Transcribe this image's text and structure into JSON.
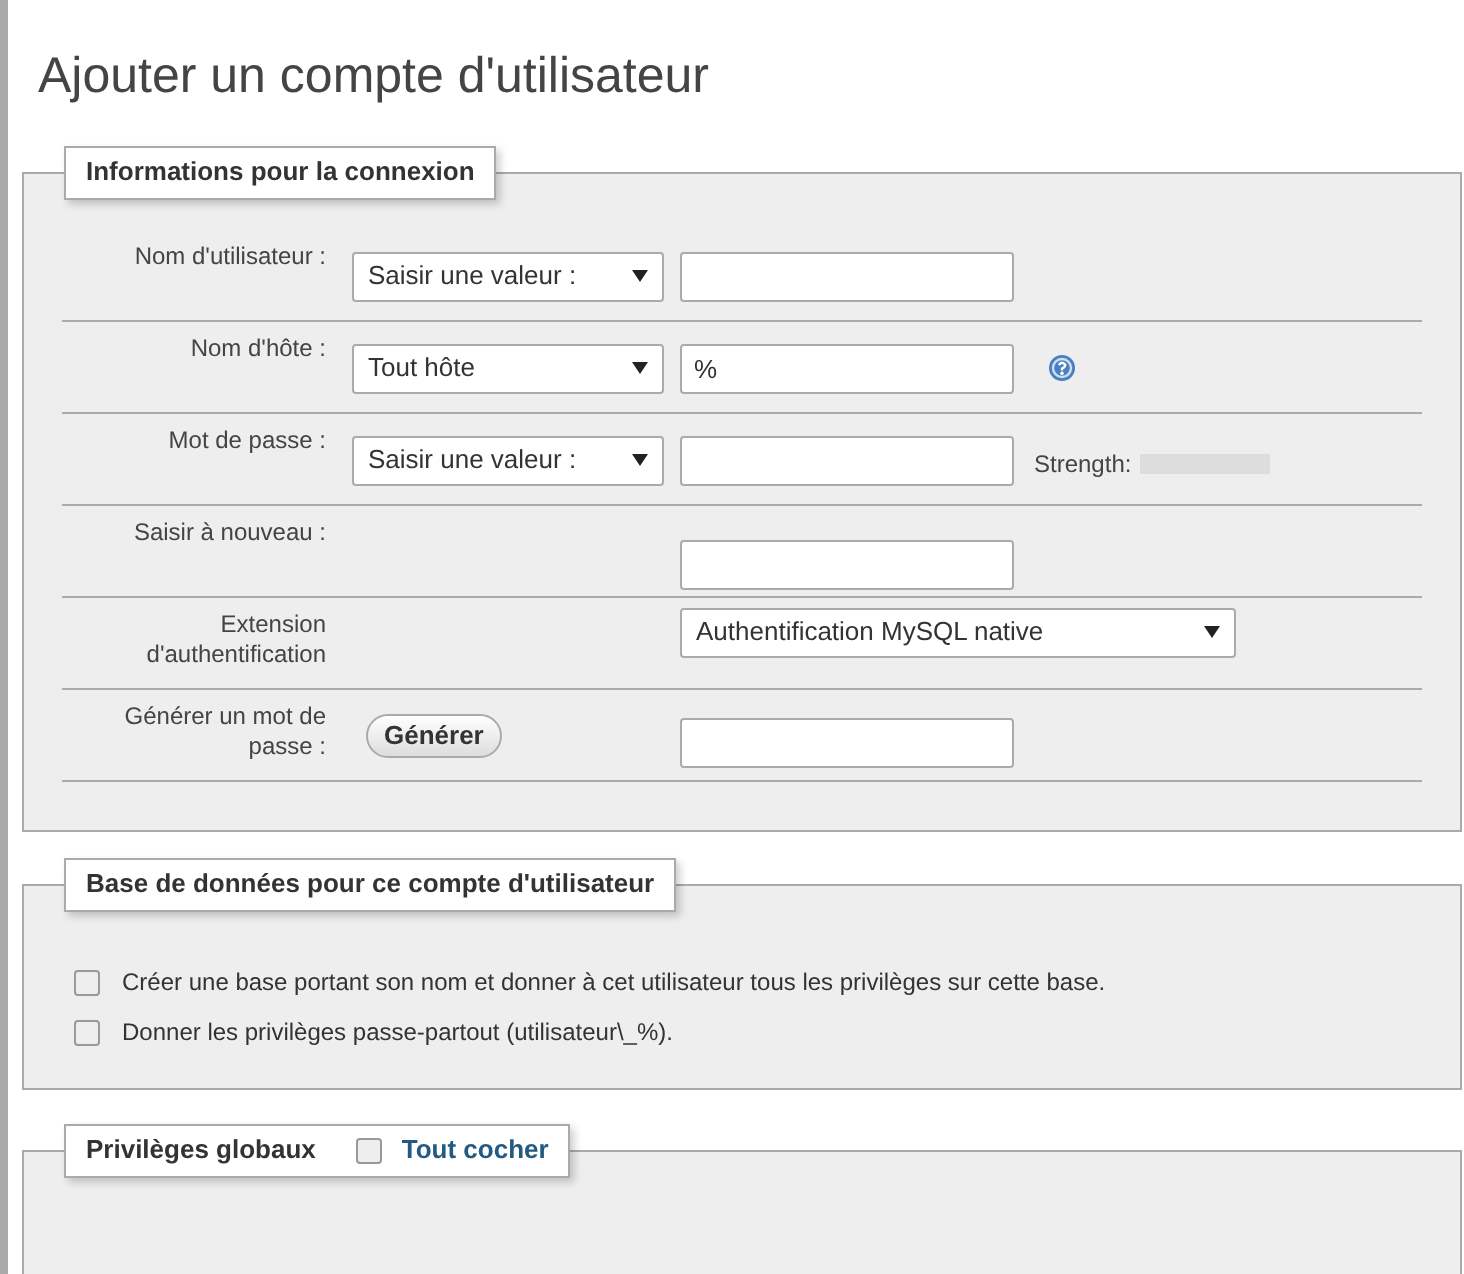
{
  "page_title": "Ajouter un compte d'utilisateur",
  "login": {
    "legend": "Informations pour la connexion",
    "rows": [
      {
        "kind": "select_input",
        "label": "Nom d'utilisateur :",
        "select": "Saisir une valeur :",
        "value": null,
        "help": false
      },
      {
        "kind": "select_input",
        "label": "Nom d'hôte :",
        "select": "Tout hôte",
        "value": "%",
        "help": true
      },
      {
        "kind": "select_input",
        "label": "Mot de passe :",
        "select": "Saisir une valeur :",
        "value": null,
        "help": false,
        "strength": {
          "label": "Strength:"
        }
      },
      {
        "kind": "input",
        "label": "Saisir à nouveau :",
        "value": null,
        "help": false
      },
      {
        "kind": "wide_select",
        "label": "Extension d'authentification",
        "select": "Authentification MySQL native",
        "help": false
      },
      {
        "kind": "button_input",
        "label": "Générer un mot de passe :",
        "button": "Générer",
        "value": null,
        "help": false
      }
    ]
  },
  "database": {
    "legend": "Base de données pour ce compte d'utilisateur",
    "options": [
      {
        "label": "Créer une base portant son nom et donner à cet utilisateur tous les privilèges sur cette base.",
        "checked": false
      },
      {
        "label": "Donner les privilèges passe-partout (utilisateur\\_%).",
        "checked": false
      }
    ]
  },
  "global": {
    "legend": "Privilèges globaux",
    "check_all": {
      "label": "Tout cocher",
      "checked": false
    }
  }
}
